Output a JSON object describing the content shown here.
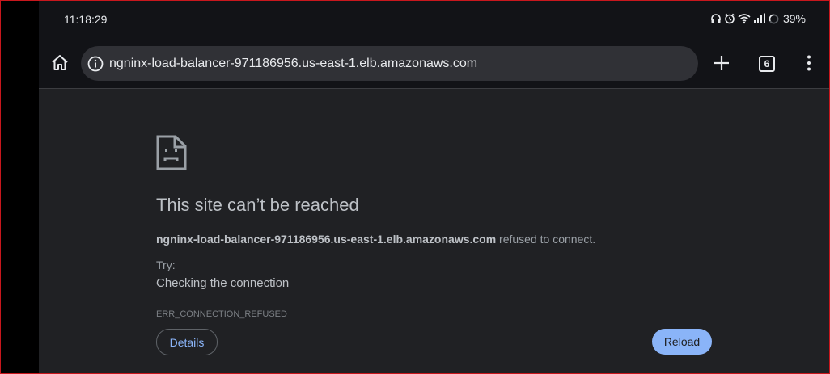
{
  "status_bar": {
    "time": "11:18:29",
    "battery": "39%",
    "icons": [
      "headphones-icon",
      "alarm-icon",
      "wifi-icon",
      "signal-icon",
      "battery-icon"
    ]
  },
  "toolbar": {
    "url": "ngninx-load-balancer-971186956.us-east-1.elb.amazonaws.com",
    "tab_count": "6",
    "icons": [
      "home-icon",
      "info-icon",
      "plus-icon",
      "tabs-icon",
      "more-vert-icon"
    ]
  },
  "error_page": {
    "icon": "sad-page-icon",
    "title": "This site can’t be reached",
    "host": "ngninx-load-balancer-971186956.us-east-1.elb.amazonaws.com",
    "message_suffix": " refused to connect.",
    "try_label": "Try:",
    "suggestion": "Checking the connection",
    "error_code": "ERR_CONNECTION_REFUSED",
    "details_label": "Details",
    "reload_label": "Reload"
  },
  "colors": {
    "background": "#202124",
    "toolbar": "#121317",
    "omnibox": "#303136",
    "accent": "#8ab4f8",
    "frame": "#c8171d"
  }
}
